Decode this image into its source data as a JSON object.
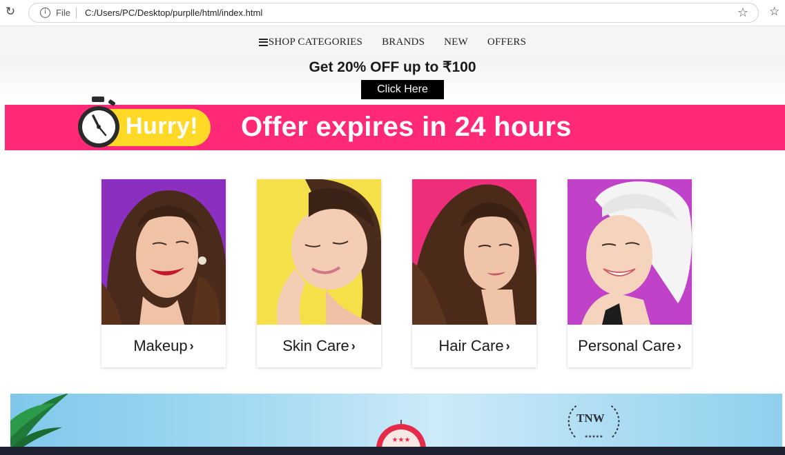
{
  "browser": {
    "scheme": "File",
    "url": "C:/Users/PC/Desktop/purplle/html/index.html"
  },
  "nav": {
    "items": [
      "SHOP CATEGORIES",
      "BRANDS",
      "NEW",
      "OFFERS"
    ]
  },
  "promo": {
    "text": "Get 20% OFF up to ₹100",
    "button_label": "Click Here"
  },
  "offer_banner": {
    "hurry": "Hurry!",
    "text": "Offer expires in 24 hours",
    "background": "#ff2978",
    "pill_color": "#ffd926"
  },
  "categories": [
    {
      "label": "Makeup",
      "bg": "#8a2fbf"
    },
    {
      "label": "Skin Care",
      "bg": "#f5e04a"
    },
    {
      "label": "Hair Care",
      "bg": "#ee2e7a"
    },
    {
      "label": "Personal Care",
      "bg": "#c042c8"
    }
  ],
  "bottom_banner": {
    "logo_text": "TNW"
  }
}
